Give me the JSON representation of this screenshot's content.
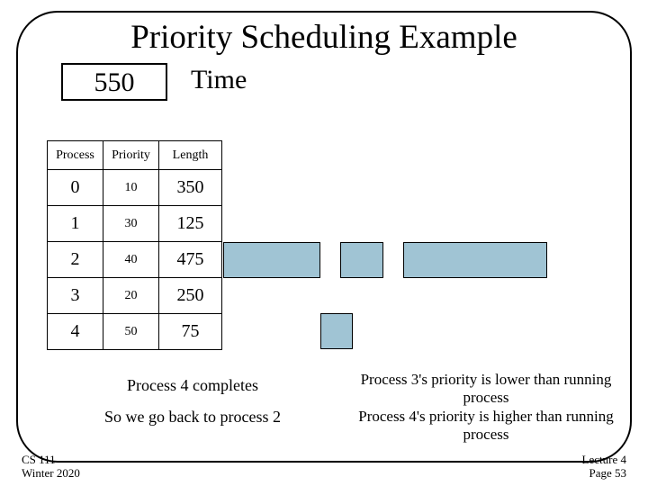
{
  "title": "Priority Scheduling Example",
  "time": {
    "value": "550",
    "label": "Time"
  },
  "table": {
    "headers": {
      "process": "Process",
      "priority": "Priority",
      "length": "Length"
    },
    "rows": [
      {
        "process": "0",
        "priority": "10",
        "length": "350"
      },
      {
        "process": "1",
        "priority": "30",
        "length": "125"
      },
      {
        "process": "2",
        "priority": "40",
        "length": "475"
      },
      {
        "process": "3",
        "priority": "20",
        "length": "250"
      },
      {
        "process": "4",
        "priority": "50",
        "length": "75"
      }
    ]
  },
  "messages": {
    "left1": "Process 4 completes",
    "left2": "So we go back to process 2",
    "right1": "Process 3's priority is lower than running process",
    "right2": "Process 4's priority is higher than running process"
  },
  "footer": {
    "left1": "CS 111",
    "left2": "Winter 2020",
    "right1": "Lecture 4",
    "right2": "Page 53"
  }
}
